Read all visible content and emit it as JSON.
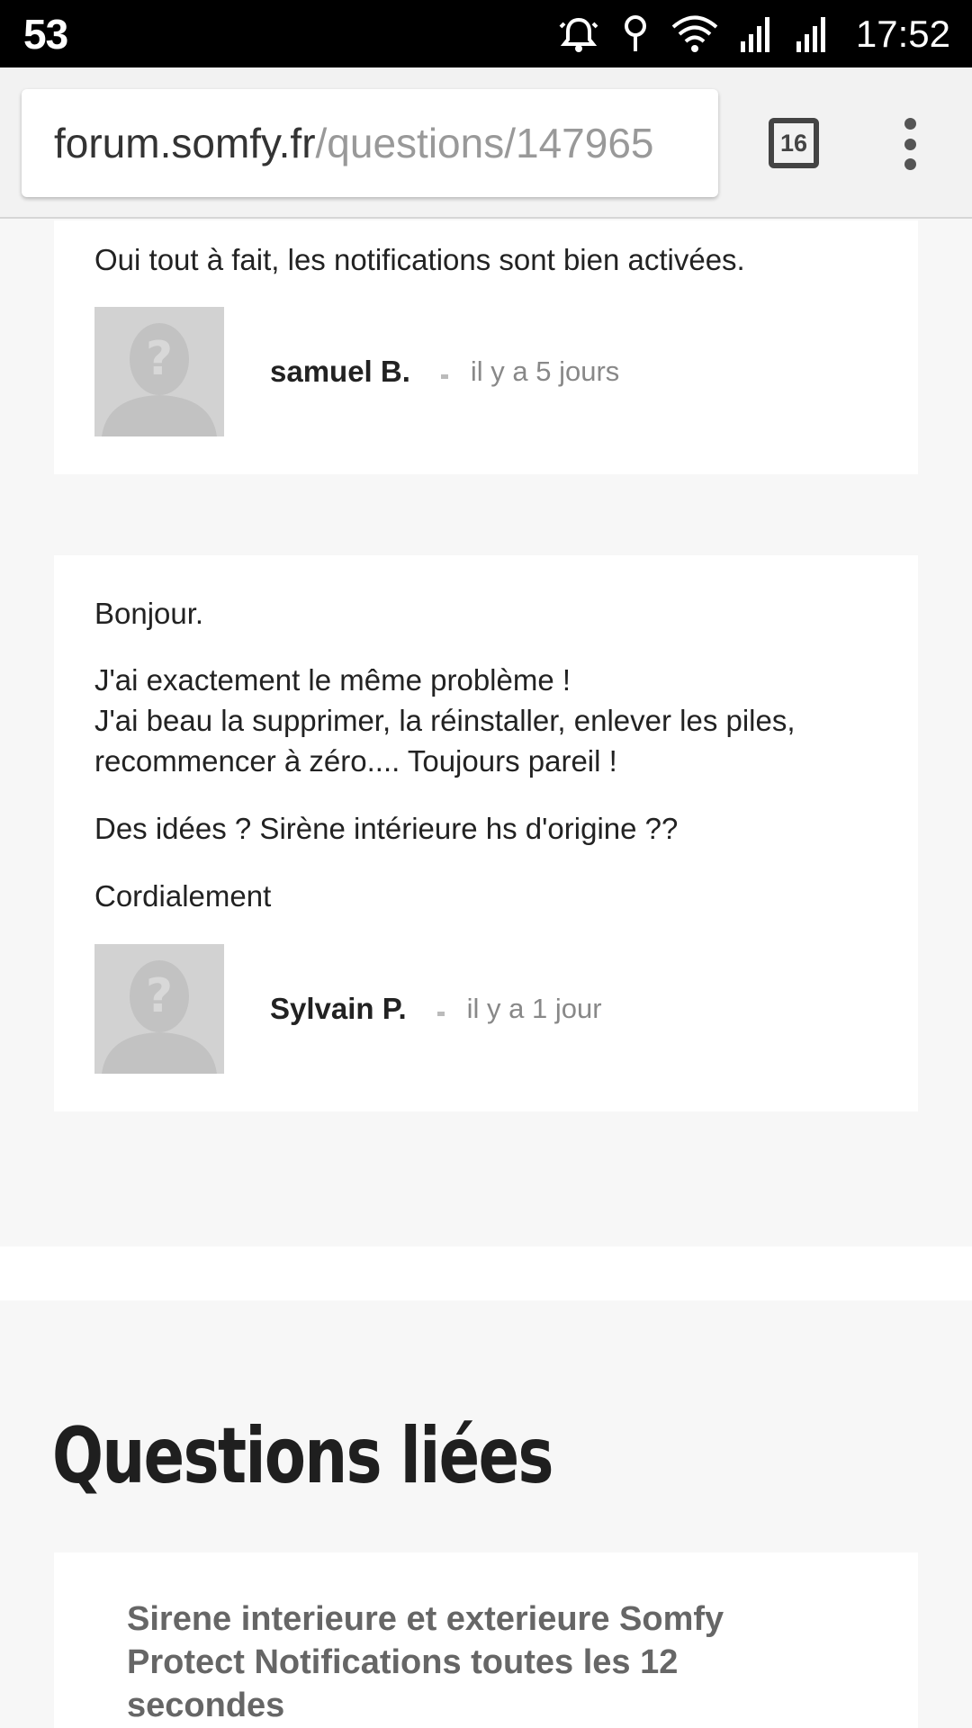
{
  "status_bar": {
    "notification_count": "53",
    "time": "17:52",
    "icons": [
      "alarm-icon",
      "location-icon",
      "wifi-icon",
      "signal-icon",
      "signal-icon"
    ]
  },
  "browser": {
    "url_host": "forum.somfy.fr",
    "url_path": "/questions/147965",
    "tab_count": "16",
    "menu_icon": "more-vert-icon"
  },
  "answers": [
    {
      "paragraphs": [
        "Oui tout à fait, les notifications sont bien activées."
      ],
      "author": "samuel B.",
      "date": "il y a 5 jours",
      "avatar": "default-avatar-icon"
    },
    {
      "paragraphs": [
        "Bonjour.",
        "J'ai exactement le même problème !",
        "J'ai beau la supprimer, la réinstaller, enlever les piles,",
        "recommencer à zéro.... Toujours pareil !",
        "Des idées ? Sirène intérieure hs d'origine ??",
        "Cordialement"
      ],
      "author": "Sylvain P.",
      "date": "il y a 1 jour",
      "avatar": "default-avatar-icon"
    }
  ],
  "related": {
    "title": "Questions liées",
    "items": [
      {
        "title": "Sirene interieure et exterieure Somfy Protect Notifications toutes les 12 secondes"
      }
    ]
  },
  "colors": {
    "status_bar_bg": "#000000",
    "page_bg": "#f7f7f7",
    "card_bg": "#ffffff",
    "muted_text": "#888888",
    "link_text": "#666666"
  }
}
